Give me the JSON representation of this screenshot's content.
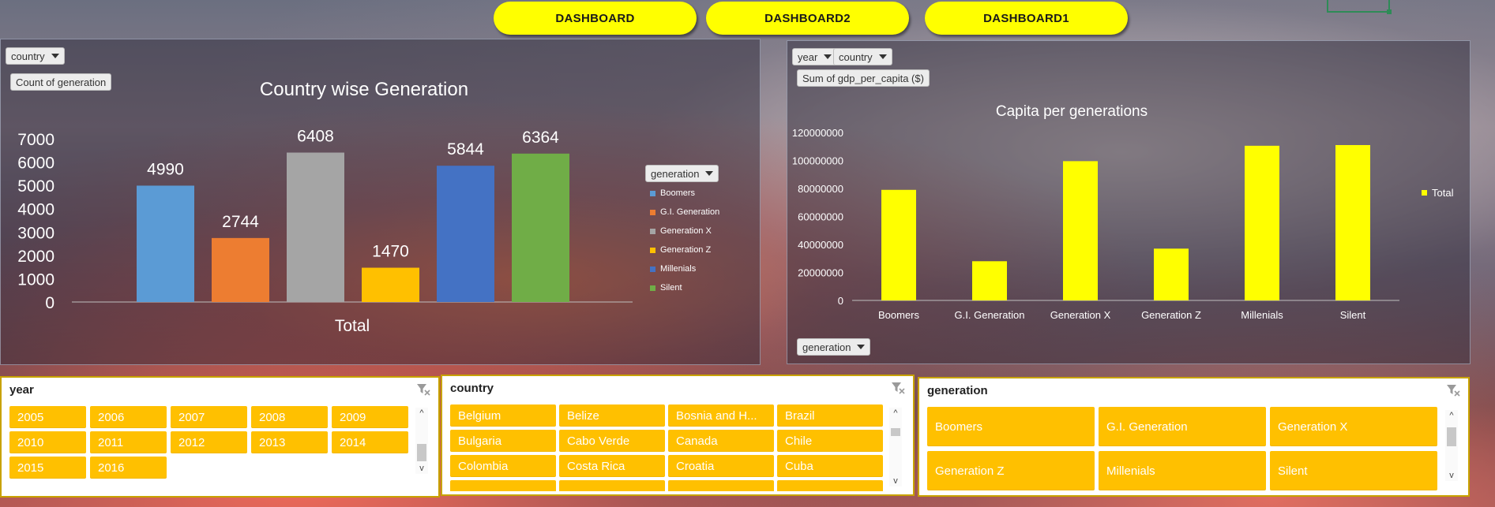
{
  "nav": {
    "buttons": [
      "DASHBOARD",
      "DASHBOARD2",
      "DASHBOARD1"
    ]
  },
  "left_chart": {
    "filter_label": "country",
    "value_label": "Count of generation",
    "legend_filter_label": "generation",
    "title": "Country wise Generation",
    "x_label": "Total",
    "y_ticks": [
      "7000",
      "6000",
      "5000",
      "4000",
      "3000",
      "2000",
      "1000",
      "0"
    ],
    "legend": [
      "Boomers",
      "G.I. Generation",
      "Generation X",
      "Generation Z",
      "Millenials",
      "Silent"
    ]
  },
  "right_chart": {
    "filter_year_label": "year",
    "filter_country_label": "country",
    "value_label": "Sum of gdp_per_capita ($)",
    "axis_filter_label": "generation",
    "title": "Capita per generations",
    "y_ticks": [
      "120000000",
      "100000000",
      "80000000",
      "60000000",
      "40000000",
      "20000000",
      "0"
    ],
    "legend": [
      "Total"
    ]
  },
  "chart_data": [
    {
      "type": "bar",
      "title": "Country wise Generation",
      "categories": [
        "Total"
      ],
      "xlabel": "Total",
      "ylabel": "",
      "ylim": [
        0,
        7000
      ],
      "series": [
        {
          "name": "Boomers",
          "values": [
            4990
          ],
          "color": "#5b9bd5"
        },
        {
          "name": "G.I. Generation",
          "values": [
            2744
          ],
          "color": "#ed7d31"
        },
        {
          "name": "Generation X",
          "values": [
            6408
          ],
          "color": "#a5a5a5"
        },
        {
          "name": "Generation Z",
          "values": [
            1470
          ],
          "color": "#ffc000"
        },
        {
          "name": "Millenials",
          "values": [
            5844
          ],
          "color": "#4472c4"
        },
        {
          "name": "Silent",
          "values": [
            6364
          ],
          "color": "#70ad47"
        }
      ],
      "data_labels": true,
      "legend_position": "right",
      "grid": false
    },
    {
      "type": "bar",
      "title": "Capita per generations",
      "categories": [
        "Boomers",
        "G.I. Generation",
        "Generation X",
        "Generation Z",
        "Millenials",
        "Silent"
      ],
      "series": [
        {
          "name": "Total",
          "values": [
            79000000,
            28000000,
            99500000,
            37000000,
            110500000,
            111000000
          ],
          "color": "#ffff00"
        }
      ],
      "ylim": [
        0,
        120000000
      ],
      "legend_position": "right",
      "grid": false
    }
  ],
  "slicers": {
    "year": {
      "title": "year",
      "items": [
        "2005",
        "2006",
        "2007",
        "2008",
        "2009",
        "2010",
        "2011",
        "2012",
        "2013",
        "2014",
        "2015",
        "2016"
      ]
    },
    "country": {
      "title": "country",
      "items": [
        "Belgium",
        "Belize",
        "Bosnia and H...",
        "Brazil",
        "Bulgaria",
        "Cabo Verde",
        "Canada",
        "Chile",
        "Colombia",
        "Costa Rica",
        "Croatia",
        "Cuba",
        "",
        "",
        "",
        ""
      ]
    },
    "generation": {
      "title": "generation",
      "items": [
        "Boomers",
        "G.I. Generation",
        "Generation X",
        "Generation Z",
        "Millenials",
        "Silent"
      ]
    }
  },
  "colors": {
    "nav_button": "#ffff00",
    "slicer_item": "#ffc000",
    "slicer_border": "#c8a200"
  }
}
